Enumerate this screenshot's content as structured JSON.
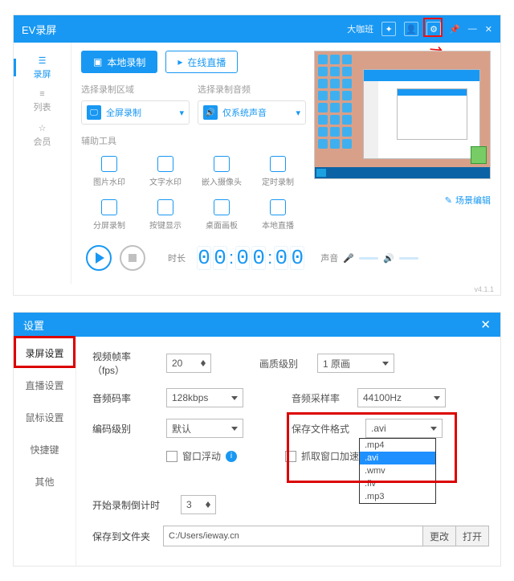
{
  "app": {
    "title": "EV录屏",
    "header_link": "大咖班",
    "version": "v4.1.1"
  },
  "sidebar": {
    "items": [
      {
        "label": "录屏"
      },
      {
        "label": "列表"
      },
      {
        "label": "会员"
      }
    ]
  },
  "modes": {
    "local": "本地录制",
    "live": "在线直播"
  },
  "sources": {
    "video_label": "选择录制区域",
    "video_value": "全屏录制",
    "audio_label": "选择录制音频",
    "audio_value": "仅系统声音"
  },
  "tools": {
    "label": "辅助工具",
    "items": [
      "图片水印",
      "文字水印",
      "嵌入摄像头",
      "定时录制",
      "分屏录制",
      "按键显示",
      "桌面画板",
      "本地直播"
    ]
  },
  "scene_link": "场景编辑",
  "controls": {
    "time_label": "时长",
    "sound_label": "声音"
  },
  "timer": [
    "0",
    "0",
    "0",
    "0",
    "0",
    "0"
  ],
  "settings": {
    "title": "设置",
    "tabs": [
      "录屏设置",
      "直播设置",
      "鼠标设置",
      "快捷键",
      "其他"
    ],
    "video_fps_label": "视频帧率（fps）",
    "video_fps_value": "20",
    "quality_label": "画质级别",
    "quality_value": "1 原画",
    "audio_br_label": "音频码率",
    "audio_br_value": "128kbps",
    "audio_sr_label": "音频采样率",
    "audio_sr_value": "44100Hz",
    "enc_label": "编码级别",
    "enc_value": "默认",
    "fmt_label": "保存文件格式",
    "fmt_value": ".avi",
    "fmt_options": [
      ".mp4",
      ".avi",
      ".wmv",
      ".flv",
      ".mp3"
    ],
    "chk_float": "窗口浮动",
    "chk_capture": "抓取窗口加速",
    "count_label": "开始录制倒计时",
    "count_value": "3",
    "path_label": "保存到文件夹",
    "path_value": "C:/Users/ieway.cn",
    "btn_change": "更改",
    "btn_open": "打开"
  }
}
